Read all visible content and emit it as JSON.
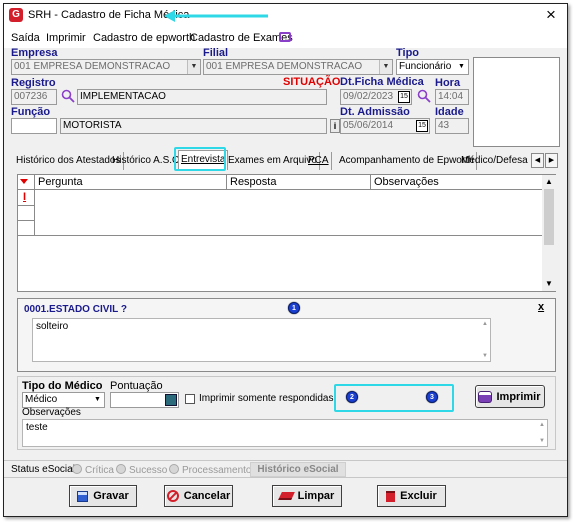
{
  "window": {
    "title": "SRH - Cadastro de Ficha Médica",
    "close_glyph": "×"
  },
  "menu": {
    "items": [
      "Saída",
      "Imprimir",
      "Cadastro de epworth",
      "Cadastro de Exames"
    ]
  },
  "form": {
    "empresa": {
      "label": "Empresa",
      "value": "001 EMPRESA DEMONSTRACAO"
    },
    "filial": {
      "label": "Filial",
      "value": "001 EMPRESA DEMONSTRACAO"
    },
    "tipo": {
      "label": "Tipo",
      "value": "Funcionário"
    },
    "registro": {
      "label": "Registro",
      "value": "007236",
      "name": "IMPLEMENTACAO"
    },
    "situacao": {
      "label": "SITUAÇÃO"
    },
    "dt_ficha": {
      "label": "Dt.Ficha Médica",
      "value": "09/02/2023",
      "cal": "15"
    },
    "hora": {
      "label": "Hora",
      "value": "14:04"
    },
    "funcao": {
      "label": "Função",
      "value": "MOTORISTA",
      "info": "i"
    },
    "dt_admissao": {
      "label": "Dt. Admissão",
      "value": "05/06/2014",
      "cal": "15"
    },
    "idade": {
      "label": "Idade",
      "value": "43"
    }
  },
  "tabs": [
    "Histórico dos Atestados",
    "Histórico A.S.O.",
    "Entrevista",
    "Exames em Arquivo",
    "PCA",
    "Acompanhamento de Epworth",
    "Médico/Defesa"
  ],
  "tab_nav": {
    "left": "◀",
    "right": "▶"
  },
  "grid": {
    "columns": [
      "Pergunta",
      "Resposta",
      "Observações"
    ],
    "row_marker": "I"
  },
  "question": {
    "title": "0001.ESTADO CIVIL ?",
    "close": "x",
    "answer": "solteiro"
  },
  "badges": [
    "1",
    "2",
    "3"
  ],
  "bottom": {
    "tipo_medico_label": "Tipo do Médico",
    "tipo_medico_value": "Médico",
    "pontuacao_label": "Pontuação",
    "checkbox_label": "Imprimir somente respondidas",
    "imprimir_label": "Imprimir",
    "observacoes_label": "Observações",
    "observacoes_value": "teste"
  },
  "status": {
    "label": "Status eSocial:",
    "options": [
      "Crítica",
      "Sucesso",
      "Processamento"
    ],
    "historico": "Histórico eSocial"
  },
  "actions": {
    "gravar": "Gravar",
    "cancelar": "Cancelar",
    "limpar": "Limpar",
    "excluir": "Excluir"
  },
  "colors": {
    "accent_cyan": "#2fd8e6",
    "label_blue": "#1a1a8c",
    "situacao_red": "#e00000",
    "badge_blue": "#1a3fd1"
  }
}
